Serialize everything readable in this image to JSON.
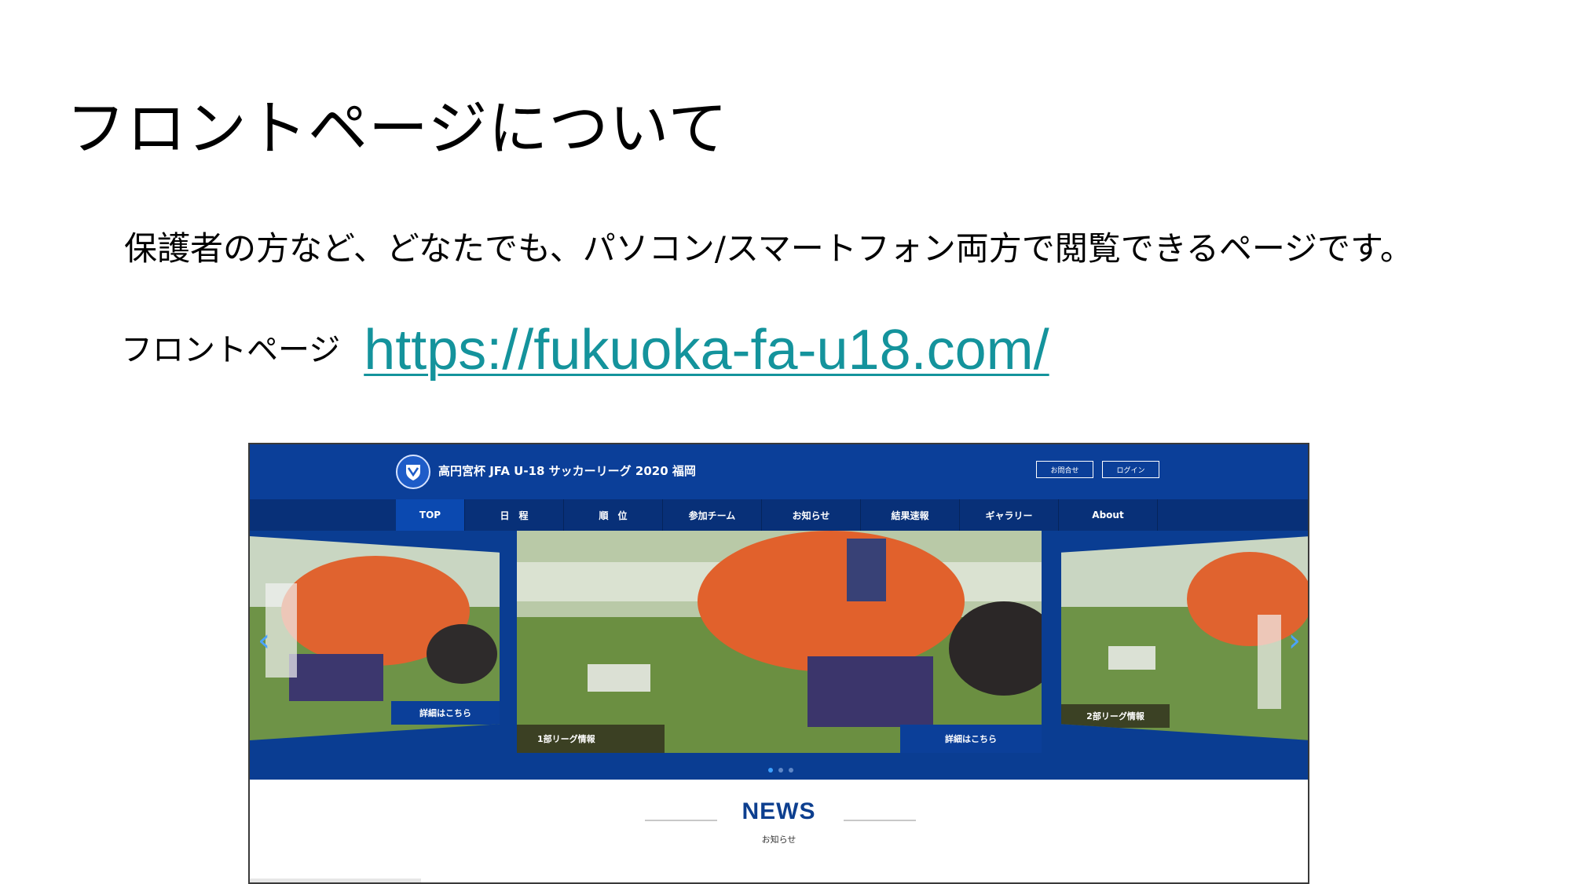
{
  "slide": {
    "title": "フロントページについて",
    "description": "保護者の方など、どなたでも、パソコン/スマートフォン両方で閲覧できるページです。",
    "link_label": "フロントページ",
    "link_text": "https://fukuoka-fa-u18.com/"
  },
  "site": {
    "title": "高円宮杯 JFA U-18 サッカーリーグ 2020 福岡",
    "header_buttons": [
      "お問合せ",
      "ログイン"
    ],
    "nav": [
      "TOP",
      "日　程",
      "順　位",
      "参加チーム",
      "お知らせ",
      "結果速報",
      "ギャラリー",
      "About"
    ],
    "nav_active_index": 0,
    "carousel": {
      "left_caption": "詳細はこちら",
      "center_caption_left": "1部リーグ情報",
      "center_caption_right": "詳細はこちら",
      "right_caption": "2部リーグ情報",
      "active_dot": 0,
      "dot_count": 3
    },
    "news": {
      "title": "NEWS",
      "subtitle": "お知らせ"
    }
  },
  "colors": {
    "header_blue": "#0b3f99",
    "nav_blue": "#083078",
    "link_teal": "#14939c",
    "news_blue": "#0d3f8f"
  }
}
